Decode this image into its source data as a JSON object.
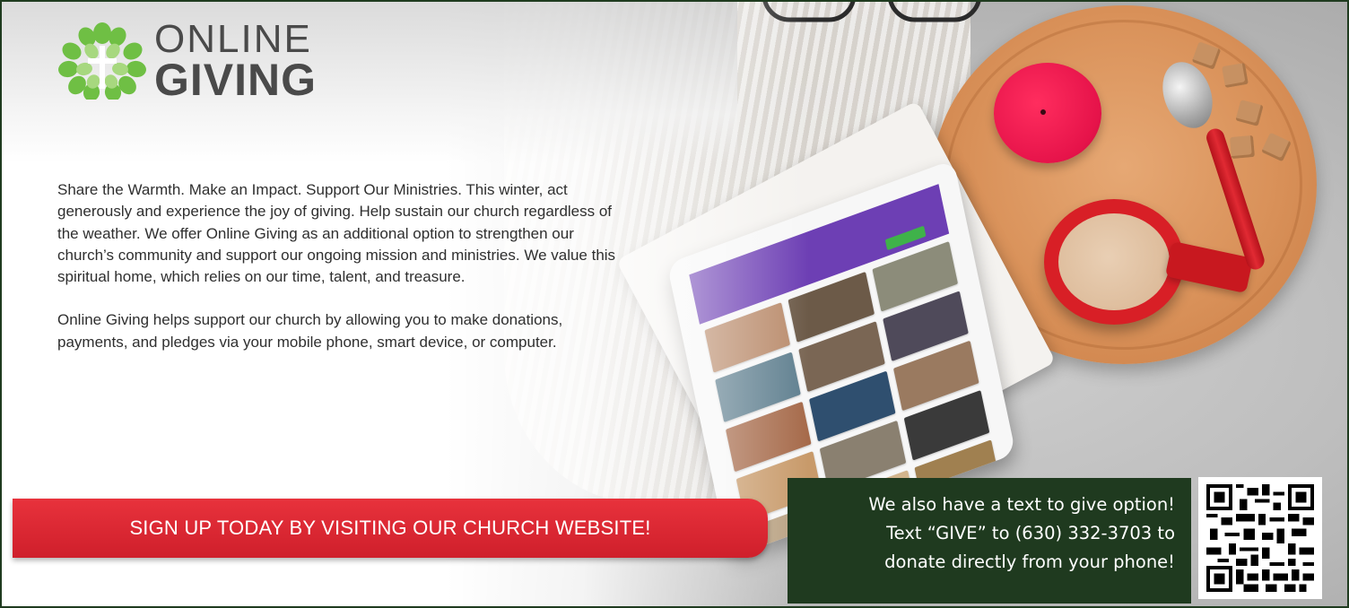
{
  "logo": {
    "line1": "ONLINE",
    "line2": "GIVING",
    "icon": "leaf-cross-icon"
  },
  "body": {
    "paragraph1": "Share the Warmth. Make an Impact. Support Our Ministries. This winter, act generously and experience the joy of giving. Help sustain our church regardless of the weather. We offer Online Giving as an additional option to strengthen our church’s community and support our ongoing mission and ministries. We value this spiritual home, which relies on our time, talent, and treasure.",
    "paragraph2": "Online Giving helps support our church by allowing you to make donations, payments, and pledges via your mobile phone, smart device, or computer."
  },
  "banner": {
    "label": "SIGN UP TODAY BY VISITING OUR CHURCH WEBSITE!"
  },
  "text_to_give": {
    "line1": "We also have a text to give option!",
    "line2": "Text “GIVE” to (630) 332-3703 to",
    "line3": "donate directly from your phone!"
  },
  "qr_code": {
    "icon": "qr-code-icon"
  },
  "colors": {
    "brand_green": "#1f3a1f",
    "banner_red": "#d9262f",
    "logo_green": "#6fbf44",
    "logo_gray": "#4a4a4a",
    "tablet_purple": "#6d3fb4"
  }
}
